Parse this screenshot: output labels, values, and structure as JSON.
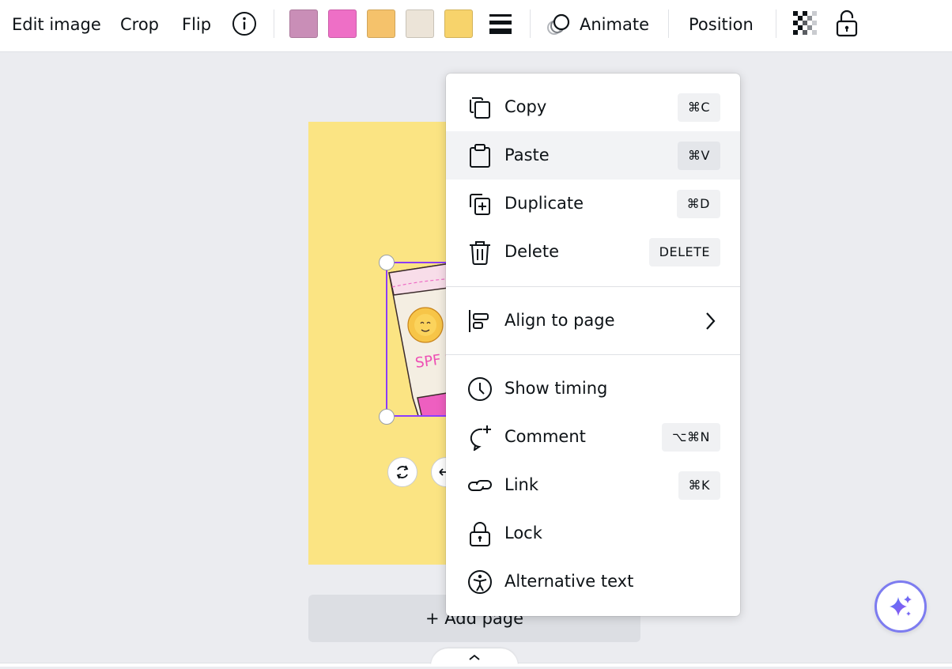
{
  "toolbar": {
    "edit_image": "Edit image",
    "crop": "Crop",
    "flip": "Flip",
    "info_icon": "info-icon",
    "swatches": [
      {
        "color": "#c98eb7"
      },
      {
        "color": "#ee6fc6"
      },
      {
        "color": "#f5c26b"
      },
      {
        "color": "#ece4d8"
      },
      {
        "color": "#f7d36b"
      }
    ],
    "animate": "Animate",
    "position": "Position"
  },
  "canvas": {
    "page_color": "#fbe483",
    "sticker_text": "SPF S",
    "add_page": "+ Add page"
  },
  "context_menu": {
    "items": [
      {
        "label": "Copy",
        "shortcut": "⌘C",
        "icon": "copy-icon"
      },
      {
        "label": "Paste",
        "shortcut": "⌘V",
        "icon": "clipboard-icon",
        "highlighted": true
      },
      {
        "label": "Duplicate",
        "shortcut": "⌘D",
        "icon": "duplicate-icon"
      },
      {
        "label": "Delete",
        "shortcut": "DELETE",
        "icon": "trash-icon"
      },
      {
        "label": "Align to page",
        "icon": "align-left-icon",
        "submenu": true
      },
      {
        "label": "Show timing",
        "icon": "clock-icon"
      },
      {
        "label": "Comment",
        "shortcut": "⌥⌘N",
        "icon": "comment-add-icon"
      },
      {
        "label": "Link",
        "shortcut": "⌘K",
        "icon": "link-icon"
      },
      {
        "label": "Lock",
        "icon": "lock-icon"
      },
      {
        "label": "Alternative text",
        "icon": "accessibility-icon"
      }
    ]
  },
  "colors": {
    "selection": "#8b3dff",
    "menu_highlight": "#f2f3f5"
  }
}
